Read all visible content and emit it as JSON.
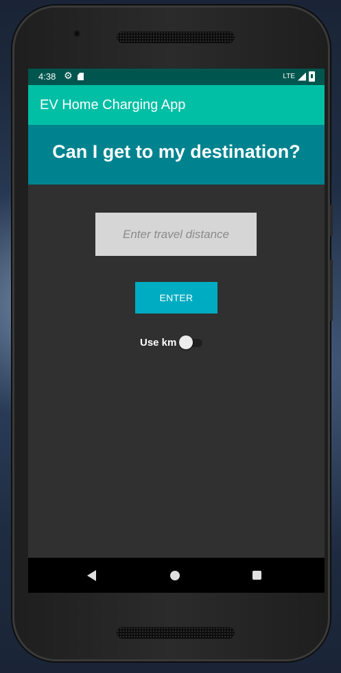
{
  "status_bar": {
    "time": "4:38",
    "network": "LTE",
    "icons": [
      "settings-gear-icon",
      "sd-card-icon",
      "signal-icon",
      "battery-icon"
    ]
  },
  "app_bar": {
    "title": "EV Home Charging App"
  },
  "header": {
    "question": "Can I get to my destination?"
  },
  "distance_input": {
    "value": "",
    "placeholder": "Enter travel distance"
  },
  "enter_button": {
    "label": "ENTER"
  },
  "units_toggle": {
    "label": "Use km",
    "checked": false
  },
  "nav_bar": {
    "icons": [
      "back-icon",
      "home-icon",
      "recents-icon"
    ]
  },
  "colors": {
    "status_bar": "#00564e",
    "app_bar": "#00bfa5",
    "header_band": "#00838f",
    "background": "#303030",
    "input_background": "#d6d6d6",
    "button": "#00acc1",
    "nav_bar": "#000000"
  }
}
